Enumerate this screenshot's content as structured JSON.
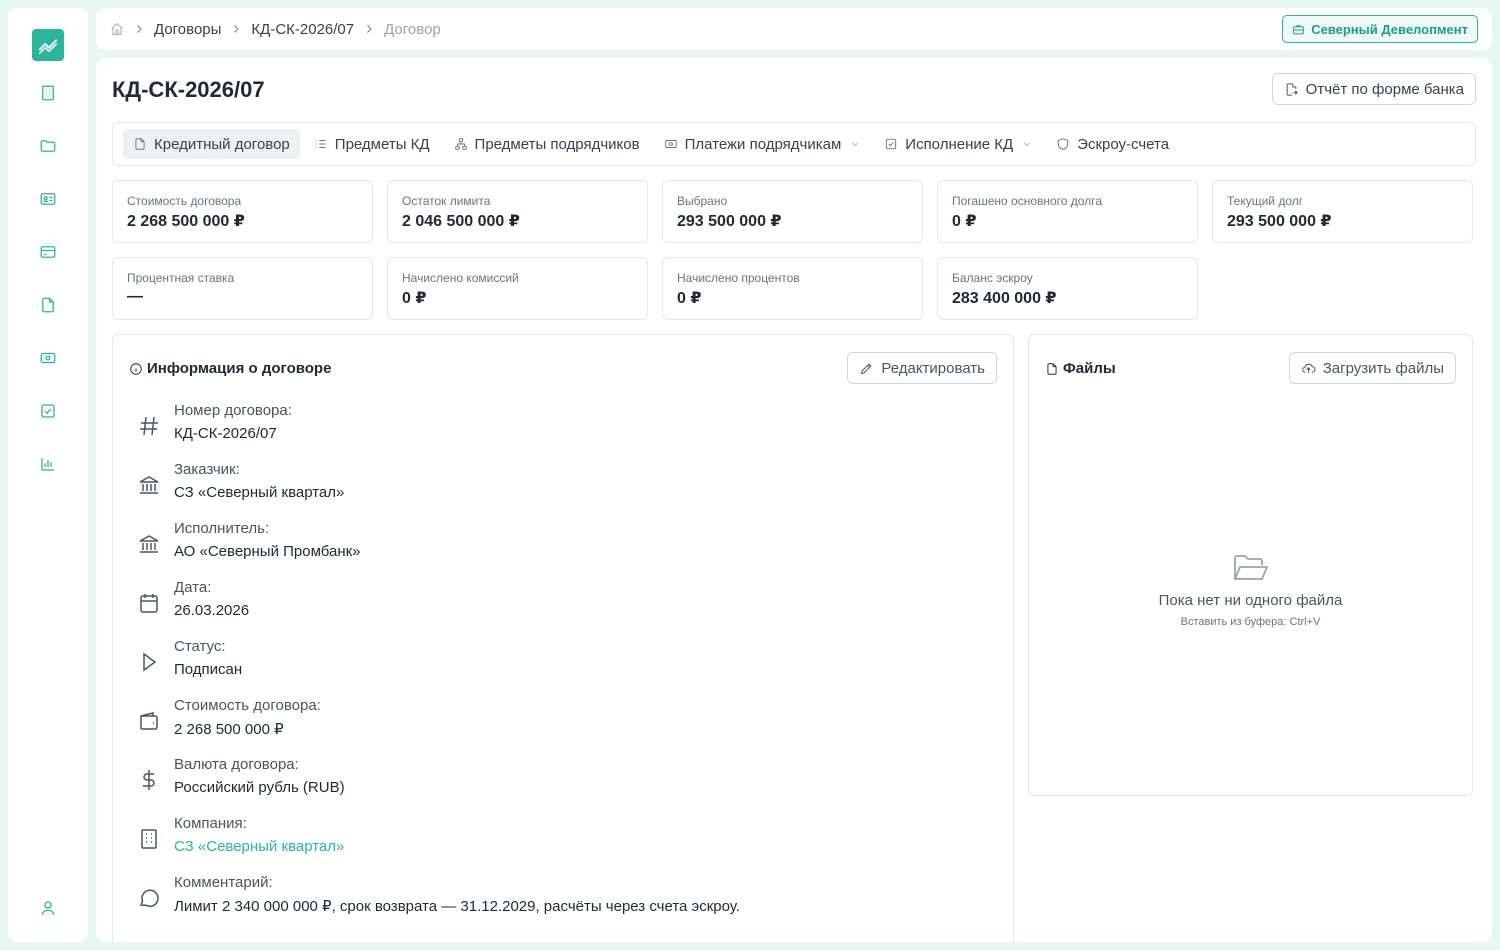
{
  "colors": {
    "accent": "#2bb59a",
    "page_bg": "#e7f7f2",
    "link": "#2bb59a"
  },
  "sidebar": {
    "logo_icon": "trend-chart-icon",
    "items": [
      {
        "icon": "building-icon"
      },
      {
        "icon": "folder-icon"
      },
      {
        "icon": "id-card-icon"
      },
      {
        "icon": "credit-card-icon"
      },
      {
        "icon": "document-icon"
      },
      {
        "icon": "banknote-icon"
      },
      {
        "icon": "checkbox-icon"
      },
      {
        "icon": "bar-chart-icon"
      }
    ],
    "user_icon": "user-icon"
  },
  "breadcrumb": {
    "home_icon": "home-icon",
    "items": [
      "Договоры",
      "КД-СК-2026/07",
      "Договор"
    ]
  },
  "company_button": {
    "label": "Северный Девелопмент",
    "icon": "briefcase-icon"
  },
  "page": {
    "title": "КД-СК-2026/07",
    "report_button": "Отчёт по форме банка"
  },
  "tabs": [
    {
      "label": "Кредитный договор",
      "icon": "file-icon",
      "active": true,
      "dropdown": false
    },
    {
      "label": "Предметы КД",
      "icon": "list-icon",
      "active": false,
      "dropdown": false
    },
    {
      "label": "Предметы подрядчиков",
      "icon": "hierarchy-icon",
      "active": false,
      "dropdown": false
    },
    {
      "label": "Платежи подрядчикам",
      "icon": "banknote-icon",
      "active": false,
      "dropdown": true
    },
    {
      "label": "Исполнение КД",
      "icon": "checkbox-icon",
      "active": false,
      "dropdown": true
    },
    {
      "label": "Эскроу-счета",
      "icon": "shield-icon",
      "active": false,
      "dropdown": false
    }
  ],
  "stats": [
    {
      "label": "Стоимость договора",
      "value": "2 268 500 000 ₽"
    },
    {
      "label": "Остаток лимита",
      "value": "2 046 500 000 ₽"
    },
    {
      "label": "Выбрано",
      "value": "293 500 000 ₽"
    },
    {
      "label": "Погашено основного долга",
      "value": "0 ₽"
    },
    {
      "label": "Текущий долг",
      "value": "293 500 000 ₽"
    },
    {
      "label": "Процентная ставка",
      "value": "—"
    },
    {
      "label": "Начислено комиссий",
      "value": "0 ₽"
    },
    {
      "label": "Начислено процентов",
      "value": "0 ₽"
    },
    {
      "label": "Баланс эскроу",
      "value": "283 400 000 ₽"
    }
  ],
  "info": {
    "title": "Информация о договоре",
    "edit_button": "Редактировать",
    "fields": [
      {
        "icon": "hash-icon",
        "label": "Номер договора:",
        "value": "КД-СК-2026/07"
      },
      {
        "icon": "bank-icon",
        "label": "Заказчик:",
        "value": "СЗ «Северный квартал»"
      },
      {
        "icon": "bank-icon",
        "label": "Исполнитель:",
        "value": "АО «Северный Промбанк»"
      },
      {
        "icon": "calendar-icon",
        "label": "Дата:",
        "value": "26.03.2026"
      },
      {
        "icon": "play-icon",
        "label": "Статус:",
        "value": "Подписан"
      },
      {
        "icon": "wallet-icon",
        "label": "Стоимость договора:",
        "value": "2 268 500 000 ₽"
      },
      {
        "icon": "dollar-icon",
        "label": "Валюта договора:",
        "value": "Российский рубль (RUB)"
      },
      {
        "icon": "building-icon",
        "label": "Компания:",
        "value": "СЗ «Северный квартал»",
        "link": true
      },
      {
        "icon": "comment-icon",
        "label": "Комментарий:",
        "value": "Лимит 2 340 000 000 ₽, срок возврата — 31.12.2029, расчёты через счета эскроу."
      }
    ]
  },
  "files": {
    "title": "Файлы",
    "upload_button": "Загрузить файлы",
    "empty_icon": "folder-open-icon",
    "empty_text": "Пока нет ни одного файла",
    "empty_hint": "Вставить из буфера: Ctrl+V"
  }
}
